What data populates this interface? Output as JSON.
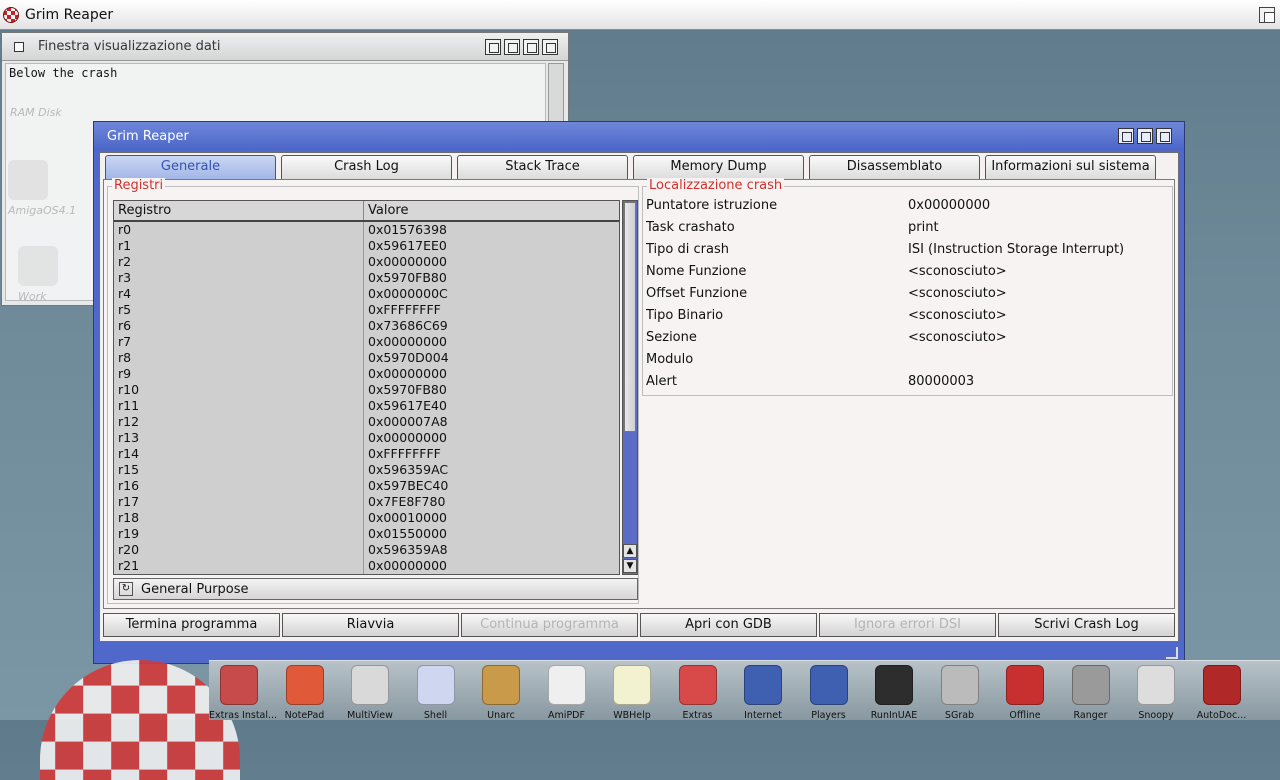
{
  "screen": {
    "title": "Grim Reaper"
  },
  "bg_window": {
    "title": "Finestra visualizzazione dati",
    "text": "Below the crash",
    "icons": [
      {
        "label": "RAM Disk"
      },
      {
        "label": "AmigaOS4.1"
      },
      {
        "label": "Work"
      }
    ]
  },
  "window": {
    "title": "Grim Reaper",
    "tabs": [
      {
        "label": "Generale",
        "active": true
      },
      {
        "label": "Crash Log"
      },
      {
        "label": "Stack Trace"
      },
      {
        "label": "Memory Dump"
      },
      {
        "label": "Disassemblato"
      },
      {
        "label": "Informazioni sul sistema"
      }
    ],
    "registers": {
      "legend": "Registri",
      "columns": [
        "Registro",
        "Valore"
      ],
      "rows": [
        [
          "r0",
          "0x01576398"
        ],
        [
          "r1",
          "0x59617EE0"
        ],
        [
          "r2",
          "0x00000000"
        ],
        [
          "r3",
          "0x5970FB80"
        ],
        [
          "r4",
          "0x0000000C"
        ],
        [
          "r5",
          "0xFFFFFFFF"
        ],
        [
          "r6",
          "0x73686C69"
        ],
        [
          "r7",
          "0x00000000"
        ],
        [
          "r8",
          "0x5970D004"
        ],
        [
          "r9",
          "0x00000000"
        ],
        [
          "r10",
          "0x5970FB80"
        ],
        [
          "r11",
          "0x59617E40"
        ],
        [
          "r12",
          "0x000007A8"
        ],
        [
          "r13",
          "0x00000000"
        ],
        [
          "r14",
          "0xFFFFFFFF"
        ],
        [
          "r15",
          "0x596359AC"
        ],
        [
          "r16",
          "0x597BEC40"
        ],
        [
          "r17",
          "0x7FE8F780"
        ],
        [
          "r18",
          "0x00010000"
        ],
        [
          "r19",
          "0x01550000"
        ],
        [
          "r20",
          "0x596359A8"
        ],
        [
          "r21",
          "0x00000000"
        ]
      ],
      "cycle_value": "General Purpose"
    },
    "crash_location": {
      "legend": "Localizzazione crash",
      "rows": [
        [
          "Puntatore istruzione",
          "0x00000000"
        ],
        [
          "Task crashato",
          "print"
        ],
        [
          "Tipo di crash",
          "ISI (Instruction Storage Interrupt)"
        ],
        [
          "Nome Funzione",
          "<sconosciuto>"
        ],
        [
          "Offset Funzione",
          "<sconosciuto>"
        ],
        [
          "Tipo Binario",
          "<sconosciuto>"
        ],
        [
          "Sezione",
          "<sconosciuto>"
        ],
        [
          "Modulo",
          ""
        ],
        [
          "Alert",
          "80000003"
        ]
      ]
    },
    "buttons": [
      {
        "label": "Termina programma",
        "enabled": true
      },
      {
        "label": "Riavvia",
        "enabled": true
      },
      {
        "label": "Continua programma",
        "enabled": false
      },
      {
        "label": "Apri con GDB",
        "enabled": true
      },
      {
        "label": "Ignora errori DSI",
        "enabled": false
      },
      {
        "label": "Scrivi Crash Log",
        "enabled": true
      }
    ]
  },
  "dock": {
    "items": [
      {
        "label": "Extras Instal...",
        "color": "#c84b4b"
      },
      {
        "label": "NotePad",
        "color": "#e05a3a"
      },
      {
        "label": "MultiView",
        "color": "#d9d9d9"
      },
      {
        "label": "Shell",
        "color": "#cfd6f0"
      },
      {
        "label": "Unarc",
        "color": "#c99a4a"
      },
      {
        "label": "AmiPDF",
        "color": "#efefef"
      },
      {
        "label": "WBHelp",
        "color": "#f2f2d0"
      },
      {
        "label": "Extras",
        "color": "#d84a4a"
      },
      {
        "label": "Internet",
        "color": "#3f5fb0"
      },
      {
        "label": "Players",
        "color": "#3f5fb0"
      },
      {
        "label": "RunInUAE",
        "color": "#2d2d2d"
      },
      {
        "label": "SGrab",
        "color": "#bbbbbb"
      },
      {
        "label": "Offline",
        "color": "#c83030"
      },
      {
        "label": "Ranger",
        "color": "#9a9a9a"
      },
      {
        "label": "Snoopy",
        "color": "#dddddd"
      },
      {
        "label": "AutoDoc...",
        "color": "#b02828"
      }
    ]
  }
}
